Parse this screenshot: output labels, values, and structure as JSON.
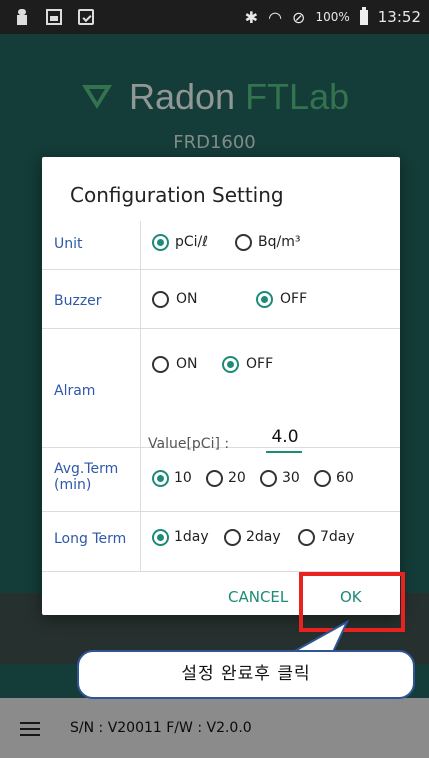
{
  "status_bar": {
    "battery": "100%",
    "time": "13:52"
  },
  "app": {
    "brand_main": "Radon ",
    "brand_accent": "FTLab",
    "model": "FRD1600",
    "serial_text": "S/N : V20011   F/W : V2.0.0"
  },
  "dialog": {
    "title": "Configuration Setting",
    "unit": {
      "label": "Unit",
      "options": [
        "pCi/ℓ",
        "Bq/m³"
      ],
      "selected": "pCi/ℓ"
    },
    "buzzer": {
      "label": "Buzzer",
      "options": [
        "ON",
        "OFF"
      ],
      "selected": "OFF"
    },
    "alarm": {
      "label": "Alram",
      "options": [
        "ON",
        "OFF"
      ],
      "selected": "OFF",
      "value_label": "Value[pCi] :",
      "value": "4.0"
    },
    "avg_term": {
      "label": "Avg.Term\n(min)",
      "options": [
        "10",
        "20",
        "30",
        "60"
      ],
      "selected": "10"
    },
    "long_term": {
      "label": "Long Term",
      "options": [
        "1day",
        "2day",
        "7day"
      ],
      "selected": "1day"
    },
    "cancel_label": "CANCEL",
    "ok_label": "OK"
  },
  "annotation": {
    "callout_text": "설정 완료후 클릭"
  },
  "colors": {
    "accent": "#1d8b78",
    "label_blue": "#2e59a8",
    "highlight": "#e8231f",
    "callout_border": "#2f5597"
  }
}
